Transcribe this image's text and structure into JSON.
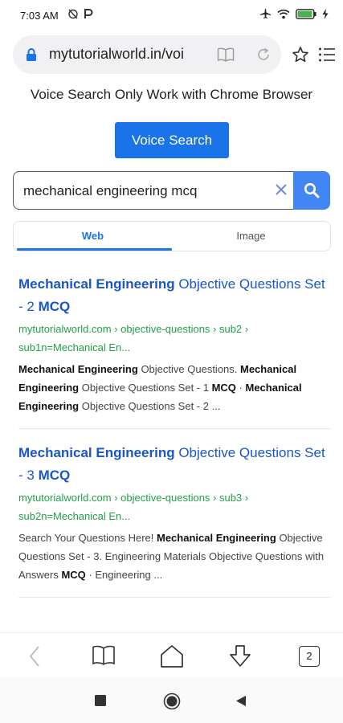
{
  "status": {
    "time": "7:03 AM"
  },
  "browser": {
    "url": "mytutorialworld.in/voi",
    "tab_count": "2"
  },
  "page": {
    "notice": "Voice Search Only Work with Chrome Browser",
    "voice_button": "Voice Search",
    "search_value": "mechanical engineering mcq",
    "tabs": [
      "Web",
      "Image"
    ]
  },
  "results": [
    {
      "title_parts": [
        {
          "t": "Mechanical Engineering",
          "b": true
        },
        {
          "t": " Objective Questions Set - 2 ",
          "b": false
        },
        {
          "t": "MCQ",
          "b": true
        }
      ],
      "url": "mytutorialworld.com › objective-questions › sub2 › sub1n=Mechanical En...",
      "snippet_parts": [
        {
          "t": "Mechanical Engineering",
          "b": true
        },
        {
          "t": " Objective Questions. ",
          "b": false
        },
        {
          "t": "Mechanical Engineering",
          "b": true
        },
        {
          "t": " Objective Questions Set - 1 ",
          "b": false
        },
        {
          "t": "MCQ",
          "b": true
        },
        {
          "t": " · ",
          "b": false
        },
        {
          "t": "Mechanical Engineering",
          "b": true
        },
        {
          "t": " Objective Questions Set - 2 ...",
          "b": false
        }
      ]
    },
    {
      "title_parts": [
        {
          "t": "Mechanical Engineering",
          "b": true
        },
        {
          "t": " Objective Questions Set - 3 ",
          "b": false
        },
        {
          "t": "MCQ",
          "b": true
        }
      ],
      "url": "mytutorialworld.com › objective-questions › sub3 › sub2n=Mechanical En...",
      "snippet_parts": [
        {
          "t": "Search Your Questions Here! ",
          "b": false
        },
        {
          "t": "Mechanical Engineering",
          "b": true
        },
        {
          "t": " Objective Questions Set - 3. Engineering Materials Objective Questions with Answers ",
          "b": false
        },
        {
          "t": "MCQ",
          "b": true
        },
        {
          "t": " · Engineering ...",
          "b": false
        }
      ]
    }
  ],
  "icons": {
    "status_left": [
      "alarm-off-icon",
      "paytm-icon"
    ],
    "status_right": [
      "airplane-icon",
      "wifi-icon",
      "battery-icon",
      "charging-icon"
    ],
    "url_bar": [
      "lock-icon",
      "reader-mode-icon",
      "reload-icon"
    ],
    "browser_actions": [
      "star-icon",
      "menu-icon"
    ],
    "bottom_nav": [
      "back-icon",
      "bookmarks-icon",
      "home-icon",
      "download-icon",
      "tabs-icon"
    ],
    "system_nav": [
      "recents-icon",
      "home-circle-icon",
      "back-triangle-icon"
    ]
  },
  "colors": {
    "accent": "#1a73e8",
    "search_button": "#4285f4",
    "result_title": "#1a56c8",
    "result_url": "#23a046"
  }
}
